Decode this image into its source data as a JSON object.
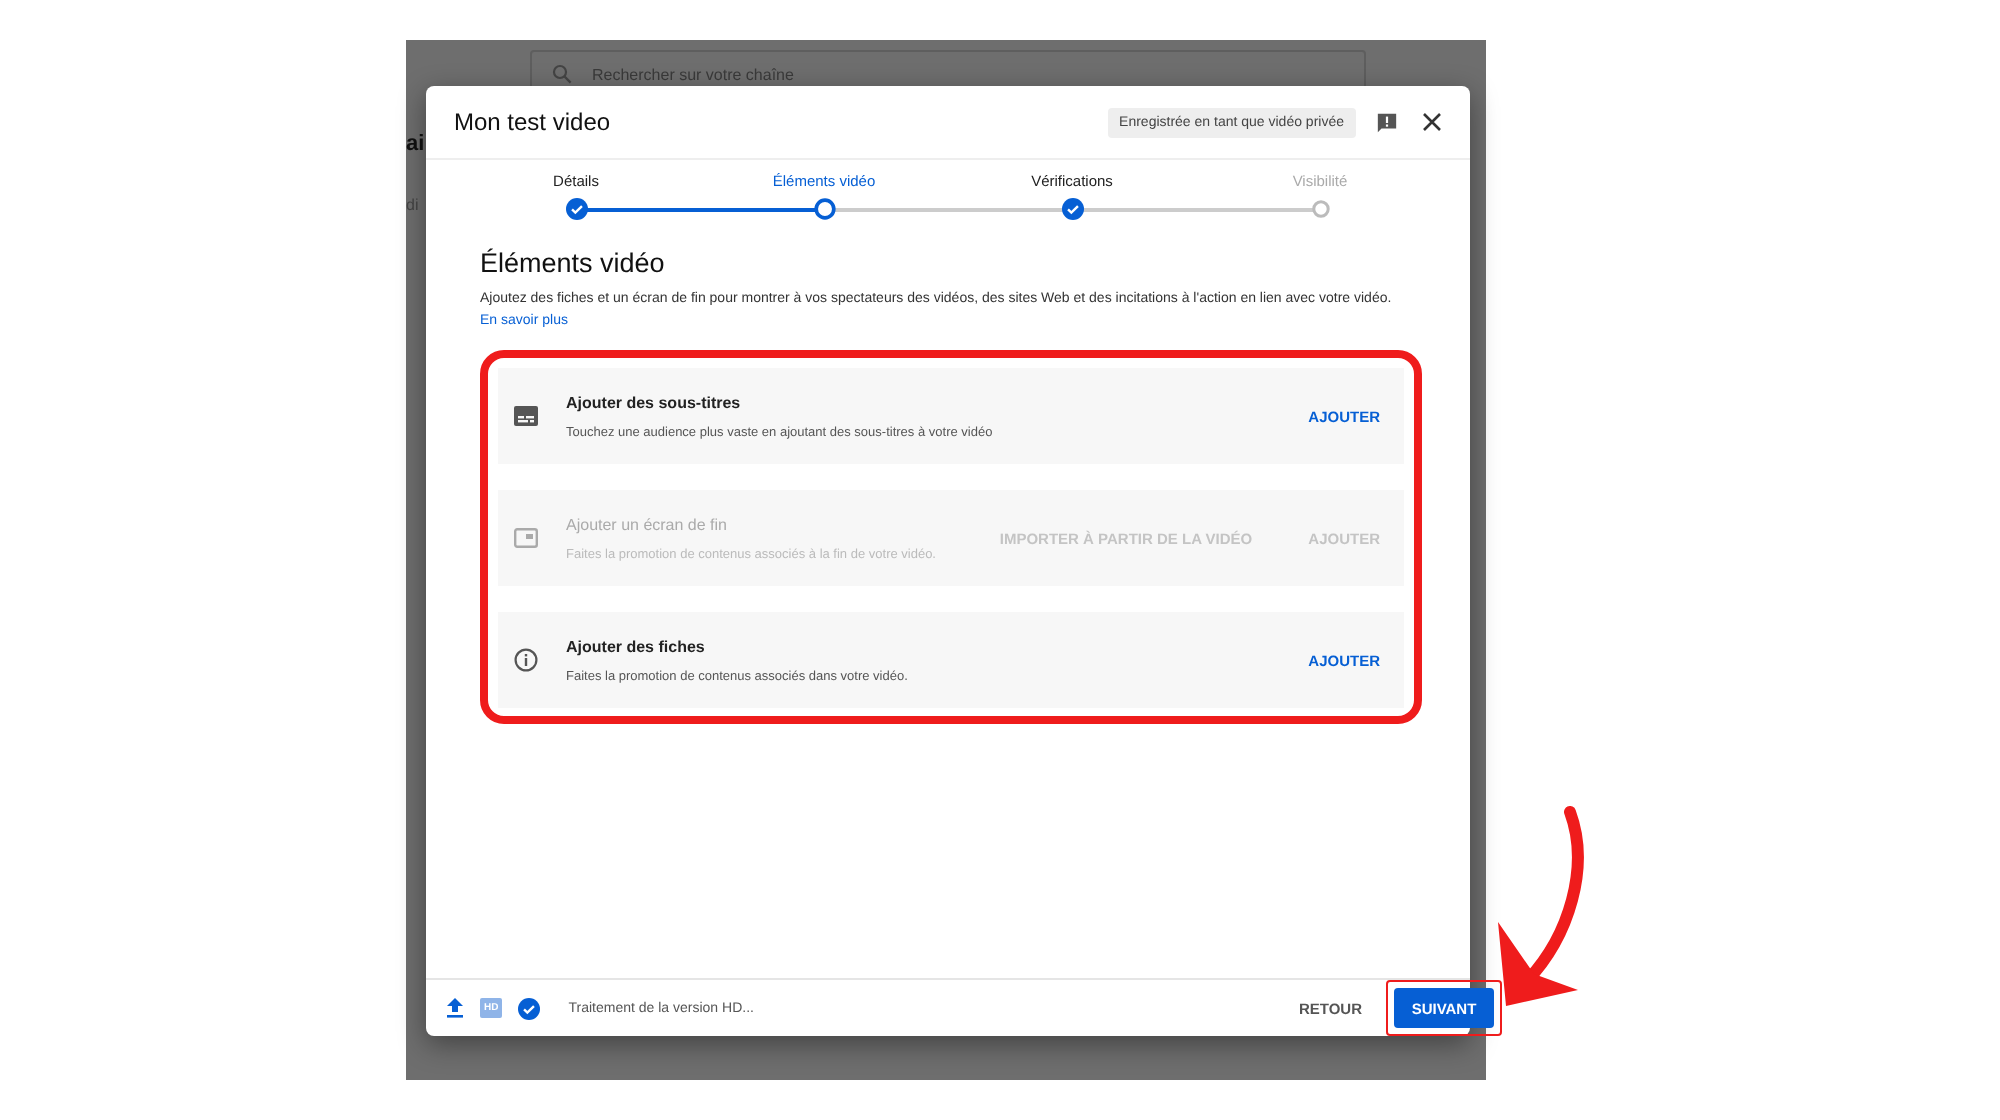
{
  "background": {
    "search": {
      "placeholder": "Rechercher sur votre chaîne"
    },
    "fragments": [
      "ai",
      "di"
    ]
  },
  "dialog": {
    "title": "Mon test video",
    "privacy_badge": "Enregistrée en tant que vidéo privée",
    "steps": [
      {
        "label": "Détails",
        "completed": true,
        "selected": false
      },
      {
        "label": "Éléments vidéo",
        "completed": false,
        "selected": true
      },
      {
        "label": "Vérifications",
        "completed": true,
        "selected": false
      },
      {
        "label": "Visibilité",
        "completed": false,
        "selected": false
      }
    ],
    "heading": "Éléments vidéo",
    "description": "Ajoutez des fiches et un écran de fin pour montrer à vos spectateurs des vidéos, des sites Web et des incitations à l'action en lien avec votre vidéo.",
    "learn_more": "En savoir plus",
    "items": [
      {
        "kind": "subtitles",
        "title": "Ajouter des sous-titres",
        "subtitle": "Touchez une audience plus vaste en ajoutant des sous-titres à votre vidéo",
        "disabled": false,
        "actions": [
          "AJOUTER"
        ]
      },
      {
        "kind": "end_screen",
        "title": "Ajouter un écran de fin",
        "subtitle": "Faites la promotion de contenus associés à la fin de votre vidéo.",
        "disabled": true,
        "actions": [
          "IMPORTER À PARTIR DE LA VIDÉO",
          "AJOUTER"
        ]
      },
      {
        "kind": "info_cards",
        "title": "Ajouter des fiches",
        "subtitle": "Faites la promotion de contenus associés dans votre vidéo.",
        "disabled": false,
        "actions": [
          "AJOUTER"
        ]
      }
    ],
    "footer": {
      "hd_label": "HD",
      "status": "Traitement de la version HD...",
      "back": "RETOUR",
      "next": "SUIVANT"
    }
  }
}
